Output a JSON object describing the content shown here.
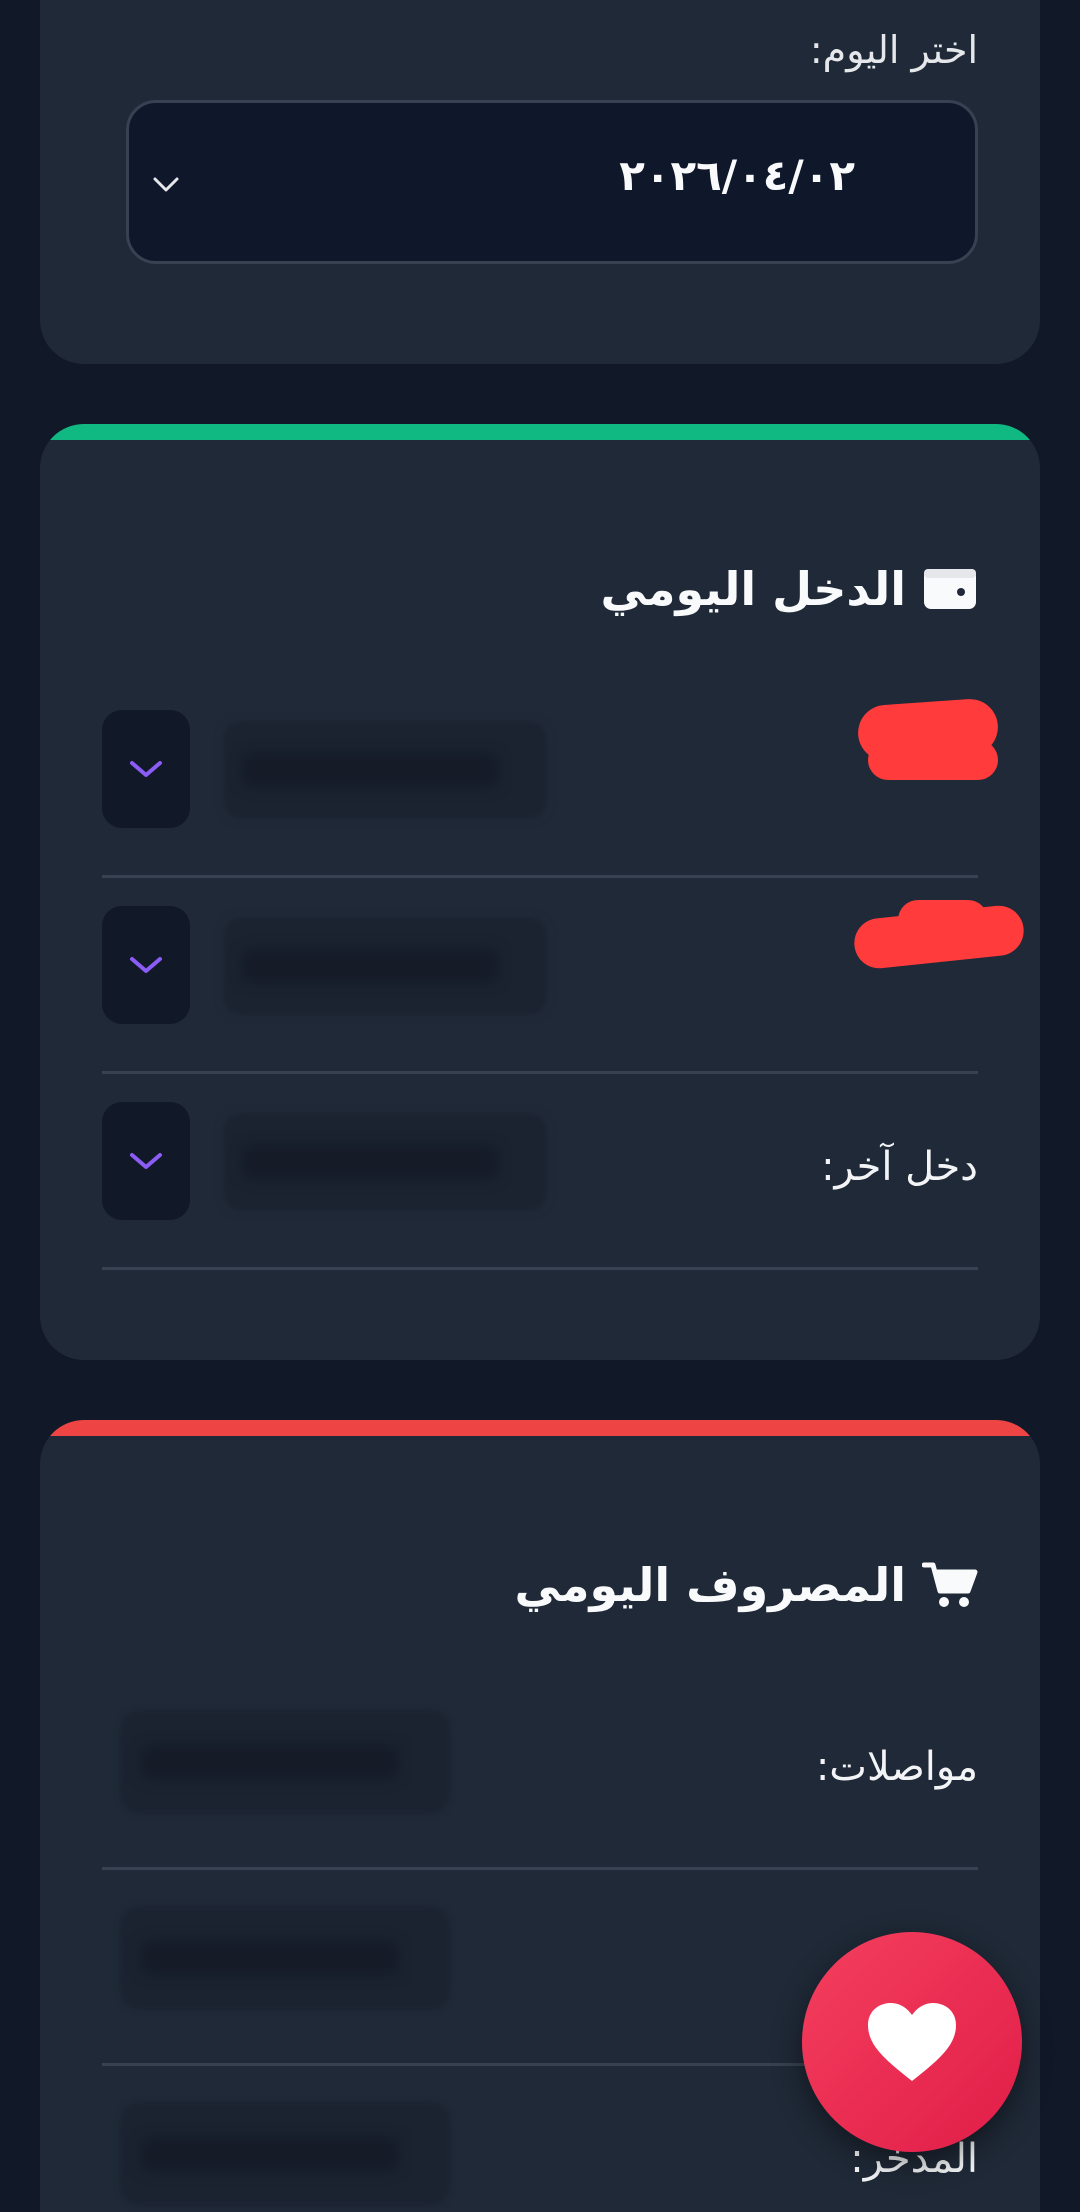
{
  "date_picker": {
    "label": "اختر اليوم:",
    "value": "٢٠٢٦/٠٤/٠٢"
  },
  "income": {
    "title": "الدخل اليومي",
    "icon": "wallet-icon",
    "accent_color": "#10b981",
    "rows": [
      {
        "label": ""
      },
      {
        "label": ""
      },
      {
        "label": "دخل آخر:"
      }
    ]
  },
  "expense": {
    "title": "المصروف اليومي",
    "icon": "shopping-cart-icon",
    "accent_color": "#ef4444",
    "rows": [
      {
        "label": "مواصلات:"
      },
      {
        "label": ""
      },
      {
        "label": "المدخر:"
      }
    ]
  },
  "fab": {
    "icon": "heart-icon",
    "color": "#e11d48"
  }
}
